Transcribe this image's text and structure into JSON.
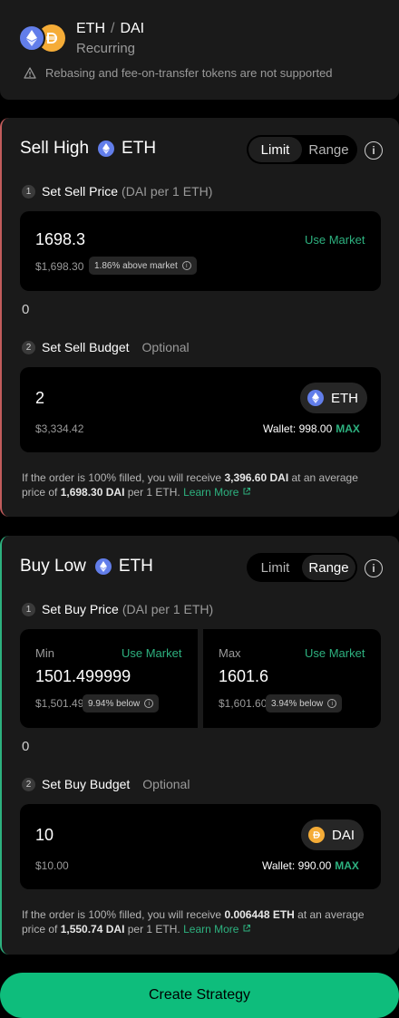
{
  "header": {
    "base": "ETH",
    "separator": "/",
    "quote": "DAI",
    "type": "Recurring",
    "warning": "Rebasing and fee-on-transfer tokens are not supported"
  },
  "sell": {
    "title": "Sell High",
    "token": "ETH",
    "toggle": {
      "limit": "Limit",
      "range": "Range",
      "active": "Limit"
    },
    "step1": {
      "num": "1",
      "label": "Set Sell Price",
      "unit": "(DAI per 1 ETH)"
    },
    "price": {
      "value": "1698.3",
      "usd": "$1,698.30",
      "badge": "1.86% above market",
      "use_market": "Use Market"
    },
    "zero": "0",
    "step2": {
      "num": "2",
      "label": "Set Sell Budget",
      "optional": "Optional"
    },
    "budget": {
      "value": "2",
      "usd": "$3,334.42",
      "token": "ETH",
      "wallet_label": "Wallet: 998.00",
      "max": "MAX"
    },
    "summary": {
      "pre": "If the order is 100% filled, you will receive ",
      "amount": "3,396.60 DAI",
      "mid": " at an average price of ",
      "price": "1,698.30 DAI",
      "post": " per 1 ETH.",
      "learn": "Learn More"
    }
  },
  "buy": {
    "title": "Buy Low",
    "token": "ETH",
    "toggle": {
      "limit": "Limit",
      "range": "Range",
      "active": "Range"
    },
    "step1": {
      "num": "1",
      "label": "Set Buy Price",
      "unit": "(DAI per 1 ETH)"
    },
    "min": {
      "label": "Min",
      "use_market": "Use Market",
      "value": "1501.499999",
      "usd": "$1,501.49",
      "badge": "9.94% below"
    },
    "max": {
      "label": "Max",
      "use_market": "Use Market",
      "value": "1601.6",
      "usd": "$1,601.60",
      "badge": "3.94% below"
    },
    "zero": "0",
    "step2": {
      "num": "2",
      "label": "Set Buy Budget",
      "optional": "Optional"
    },
    "budget": {
      "value": "10",
      "usd": "$10.00",
      "token": "DAI",
      "wallet_label": "Wallet: 990.00",
      "max": "MAX"
    },
    "summary": {
      "pre": "If the order is 100% filled, you will receive ",
      "amount": "0.006448 ETH",
      "mid": " at an average price of ",
      "price": "1,550.74 DAI",
      "post": " per 1 ETH.",
      "learn": "Learn More"
    }
  },
  "create_button": "Create Strategy",
  "colors": {
    "accent_green": "#2db17f",
    "sell_border": "#c25c5c",
    "eth_blue": "#627eea",
    "dai_yellow": "#f5ac37",
    "button_green": "#0ebd7c"
  },
  "icons": {
    "eth": "ethereum-icon",
    "dai": "dai-icon",
    "warning": "warning-triangle-icon",
    "info": "info-circle-icon",
    "external": "external-link-icon"
  }
}
